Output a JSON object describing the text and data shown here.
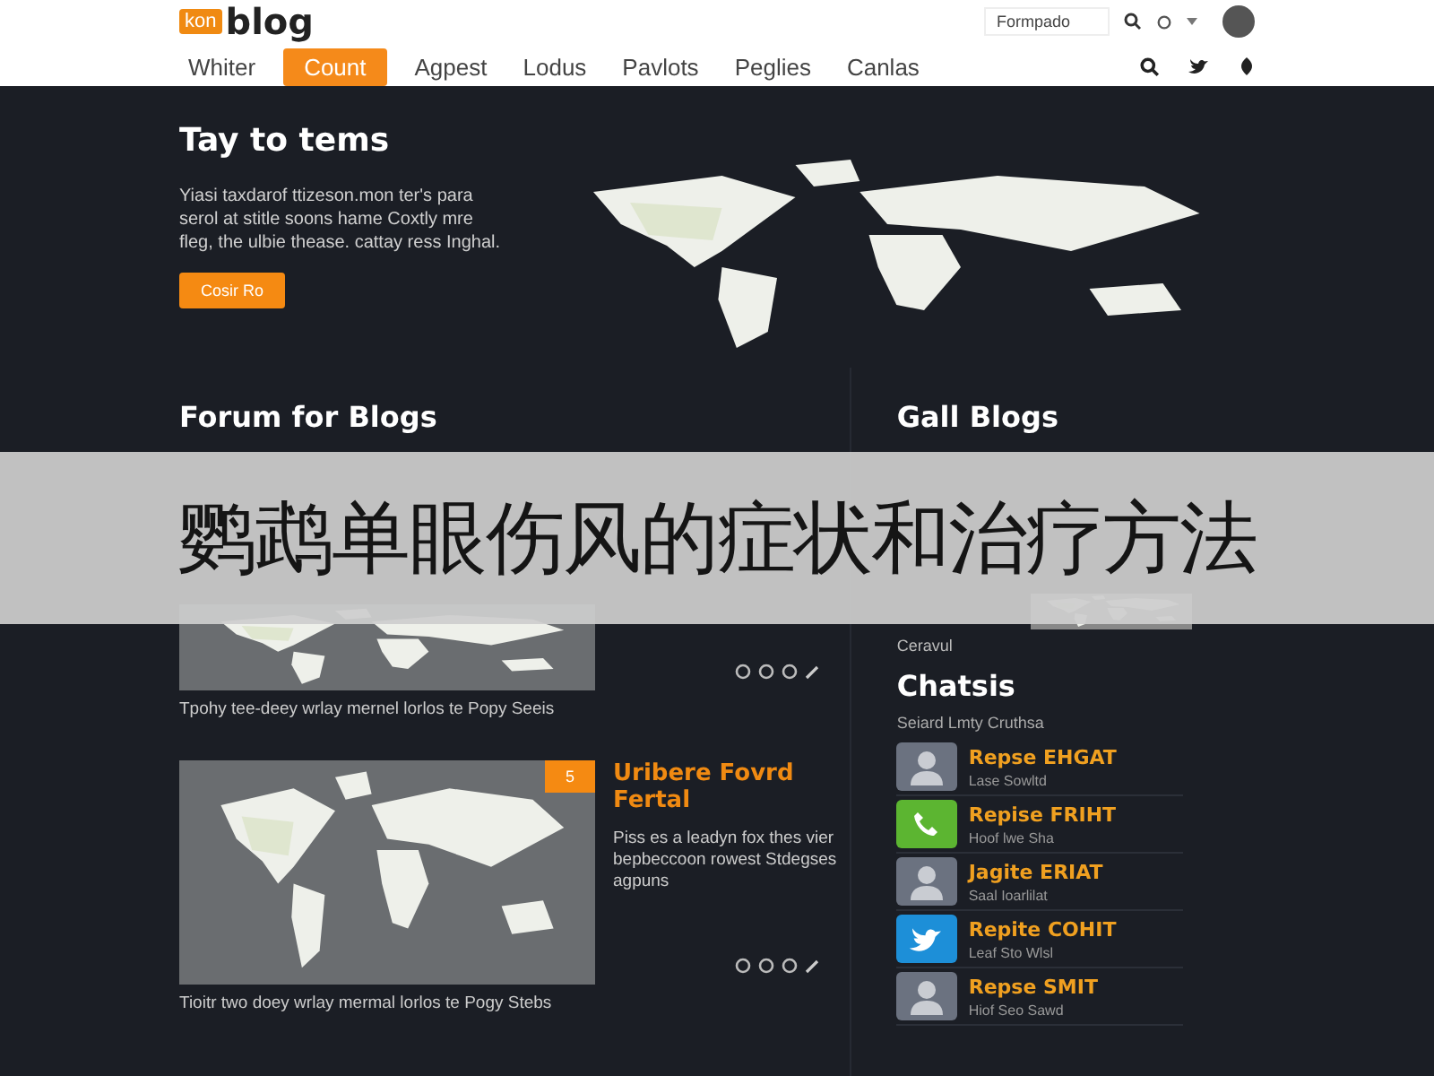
{
  "header": {
    "logo_badge": "kon",
    "logo_text": "blog",
    "search": {
      "placeholder": "Formpado"
    },
    "nav": [
      {
        "label": "Whiter",
        "selected": false
      },
      {
        "label": "Count",
        "selected": true
      },
      {
        "label": "Agpest",
        "selected": false
      },
      {
        "label": "Lodus",
        "selected": false
      },
      {
        "label": "Pavlots",
        "selected": false
      },
      {
        "label": "Peglies",
        "selected": false
      },
      {
        "label": "Canlas",
        "selected": false
      }
    ]
  },
  "hero": {
    "title": "Tay to tems",
    "text": "Yiasi taxdarof ttizeson.mon ter's para serol at stitle soons hame Coxtly mre fleg, the ulbie thease. cattay ress Inghal.",
    "button": "Cosir Ro"
  },
  "forum": {
    "title": "Forum for Blogs",
    "cards": [
      {
        "caption": "Tpohy tee-deey wrlay mernel lorlos te Popy Seeis"
      },
      {
        "badge": "5",
        "title": "Uribere Fovrd Fertal",
        "text": "Piss es a leadyn fox thes vier bepbeccoon rowest Stdegses agpuns",
        "caption": "Tioitr two doey wrlay mermal lorlos te Pogy Stebs"
      }
    ]
  },
  "gall": {
    "title": "Gall Blogs",
    "caption": "Ceravul"
  },
  "chats": {
    "title": "Chatsis",
    "subtitle": "Seiard Lmty Cruthsa",
    "items": [
      {
        "kind": "photo",
        "name": "Repse EHGAT",
        "meta": "Lase Sowltd"
      },
      {
        "kind": "phone",
        "name": "Repise FRIHT",
        "meta": "Hoof lwe Sha"
      },
      {
        "kind": "photo",
        "name": "Jagite ERIAT",
        "meta": "Saal Ioarlilat"
      },
      {
        "kind": "twitter",
        "name": "Repite COHIT",
        "meta": "Leaf Sto Wlsl"
      },
      {
        "kind": "photo",
        "name": "Repse SMIT",
        "meta": "Hiof Seo Sawd"
      }
    ]
  },
  "banner": {
    "text": "鹦鹉单眼伤风的症状和治疗方法"
  }
}
